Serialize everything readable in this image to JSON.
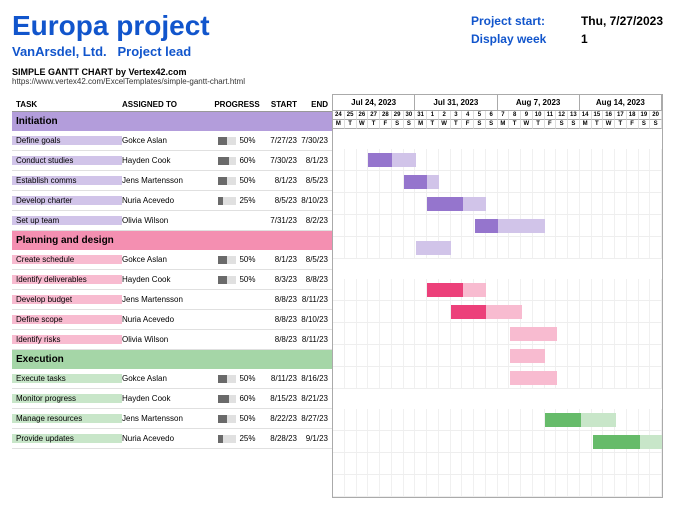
{
  "header": {
    "title": "Europa project",
    "company": "VanArsdel, Ltd.",
    "lead_label": "Project lead",
    "project_start_label": "Project start:",
    "project_start_value": "Thu, 7/27/2023",
    "display_week_label": "Display week",
    "display_week_value": "1",
    "credit": "SIMPLE GANTT CHART by Vertex42.com",
    "credit_link": "https://www.vertex42.com/ExcelTemplates/simple-gantt-chart.html"
  },
  "columns": {
    "task": "TASK",
    "assigned": "ASSIGNED TO",
    "progress": "PROGRESS",
    "start": "START",
    "end": "END"
  },
  "weeks": [
    "Jul 24, 2023",
    "Jul 31, 2023",
    "Aug 7, 2023",
    "Aug 14, 2023"
  ],
  "days": [
    "24",
    "25",
    "26",
    "27",
    "28",
    "29",
    "30",
    "31",
    "1",
    "2",
    "3",
    "4",
    "5",
    "6",
    "7",
    "8",
    "9",
    "10",
    "11",
    "12",
    "13",
    "14",
    "15",
    "16",
    "17",
    "18",
    "19",
    "20"
  ],
  "dows": [
    "M",
    "T",
    "W",
    "T",
    "F",
    "S",
    "S",
    "M",
    "T",
    "W",
    "T",
    "F",
    "S",
    "S",
    "M",
    "T",
    "W",
    "T",
    "F",
    "S",
    "S",
    "M",
    "T",
    "W",
    "T",
    "F",
    "S",
    "S"
  ],
  "sections": [
    {
      "name": "Initiation",
      "class": "sec-init",
      "row_class": "tr-init",
      "colors": [
        "bar-init-done",
        "bar-init-todo"
      ],
      "tasks": [
        {
          "name": "Define goals",
          "assigned": "Gokce Aslan",
          "progress": "50%",
          "start": "7/27/23",
          "end": "7/30/23",
          "bar_start": 3,
          "bar_len": 4,
          "done": 2
        },
        {
          "name": "Conduct studies",
          "assigned": "Hayden Cook",
          "progress": "60%",
          "start": "7/30/23",
          "end": "8/1/23",
          "bar_start": 6,
          "bar_len": 3,
          "done": 2
        },
        {
          "name": "Establish comms",
          "assigned": "Jens Martensson",
          "progress": "50%",
          "start": "8/1/23",
          "end": "8/5/23",
          "bar_start": 8,
          "bar_len": 5,
          "done": 3
        },
        {
          "name": "Develop charter",
          "assigned": "Nuria Acevedo",
          "progress": "25%",
          "start": "8/5/23",
          "end": "8/10/23",
          "bar_start": 12,
          "bar_len": 6,
          "done": 2
        },
        {
          "name": "Set up team",
          "assigned": "Olivia Wilson",
          "progress": "",
          "start": "7/31/23",
          "end": "8/2/23",
          "bar_start": 7,
          "bar_len": 3,
          "done": 0
        }
      ]
    },
    {
      "name": "Planning and design",
      "class": "sec-plan",
      "row_class": "tr-plan",
      "colors": [
        "bar-plan-done",
        "bar-plan-todo"
      ],
      "tasks": [
        {
          "name": "Create schedule",
          "assigned": "Gokce Aslan",
          "progress": "50%",
          "start": "8/1/23",
          "end": "8/5/23",
          "bar_start": 8,
          "bar_len": 5,
          "done": 3
        },
        {
          "name": "Identify deliverables",
          "assigned": "Hayden Cook",
          "progress": "50%",
          "start": "8/3/23",
          "end": "8/8/23",
          "bar_start": 10,
          "bar_len": 6,
          "done": 3
        },
        {
          "name": "Develop budget",
          "assigned": "Jens Martensson",
          "progress": "",
          "start": "8/8/23",
          "end": "8/11/23",
          "bar_start": 15,
          "bar_len": 4,
          "done": 0
        },
        {
          "name": "Define scope",
          "assigned": "Nuria Acevedo",
          "progress": "",
          "start": "8/8/23",
          "end": "8/10/23",
          "bar_start": 15,
          "bar_len": 3,
          "done": 0
        },
        {
          "name": "Identify risks",
          "assigned": "Olivia Wilson",
          "progress": "",
          "start": "8/8/23",
          "end": "8/11/23",
          "bar_start": 15,
          "bar_len": 4,
          "done": 0
        }
      ]
    },
    {
      "name": "Execution",
      "class": "sec-exec",
      "row_class": "tr-exec",
      "colors": [
        "bar-exec-done",
        "bar-exec-todo"
      ],
      "tasks": [
        {
          "name": "Execute tasks",
          "assigned": "Gokce Aslan",
          "progress": "50%",
          "start": "8/11/23",
          "end": "8/16/23",
          "bar_start": 18,
          "bar_len": 6,
          "done": 3
        },
        {
          "name": "Monitor progress",
          "assigned": "Hayden Cook",
          "progress": "60%",
          "start": "8/15/23",
          "end": "8/21/23",
          "bar_start": 22,
          "bar_len": 6,
          "done": 4
        },
        {
          "name": "Manage resources",
          "assigned": "Jens Martensson",
          "progress": "50%",
          "start": "8/22/23",
          "end": "8/27/23",
          "bar_start": 28,
          "bar_len": 0,
          "done": 0
        },
        {
          "name": "Provide updates",
          "assigned": "Nuria Acevedo",
          "progress": "25%",
          "start": "8/28/23",
          "end": "9/1/23",
          "bar_start": 28,
          "bar_len": 0,
          "done": 0
        }
      ]
    }
  ]
}
